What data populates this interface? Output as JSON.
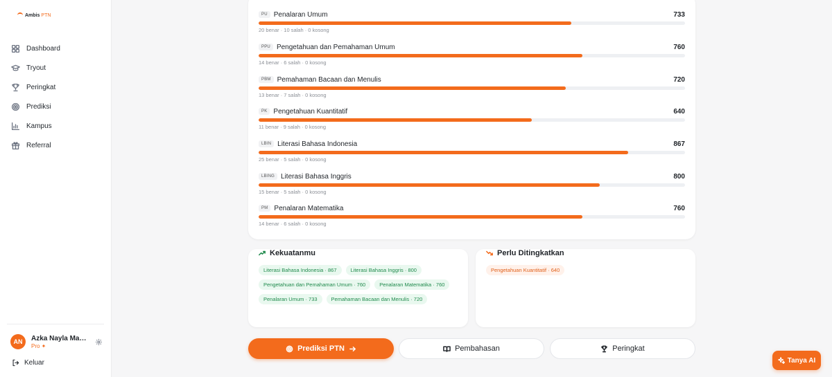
{
  "brand": {
    "name": "Ambis",
    "suffix": "PTN"
  },
  "sidebar": {
    "items": [
      {
        "label": "Dashboard",
        "icon": "grid-icon"
      },
      {
        "label": "Tryout",
        "icon": "graduation-cap-icon"
      },
      {
        "label": "Peringkat",
        "icon": "trophy-icon"
      },
      {
        "label": "Prediksi",
        "icon": "target-icon"
      },
      {
        "label": "Kampus",
        "icon": "bar-chart-icon"
      },
      {
        "label": "Referral",
        "icon": "gift-icon"
      }
    ],
    "user": {
      "initials": "AN",
      "name": "Azka Nayla Maymuna",
      "plan": "Pro ✦"
    },
    "logout_label": "Keluar"
  },
  "subtests": [
    {
      "code": "PU",
      "name": "Penalaran Umum",
      "score": "733",
      "progress": 73.3,
      "stats": "20 benar · 10 salah · 0 kosong"
    },
    {
      "code": "PPU",
      "name": "Pengetahuan dan Pemahaman Umum",
      "score": "760",
      "progress": 76.0,
      "stats": "14 benar · 6 salah · 0 kosong"
    },
    {
      "code": "PBM",
      "name": "Pemahaman Bacaan dan Menulis",
      "score": "720",
      "progress": 72.0,
      "stats": "13 benar · 7 salah · 0 kosong"
    },
    {
      "code": "PK",
      "name": "Pengetahuan Kuantitatif",
      "score": "640",
      "progress": 64.0,
      "stats": "11 benar · 9 salah · 0 kosong"
    },
    {
      "code": "LBIN",
      "name": "Literasi Bahasa Indonesia",
      "score": "867",
      "progress": 86.7,
      "stats": "25 benar · 5 salah · 0 kosong"
    },
    {
      "code": "LBING",
      "name": "Literasi Bahasa Inggris",
      "score": "800",
      "progress": 80.0,
      "stats": "15 benar · 5 salah · 0 kosong"
    },
    {
      "code": "PM",
      "name": "Penalaran Matematika",
      "score": "760",
      "progress": 76.0,
      "stats": "14 benar · 6 salah · 0 kosong"
    }
  ],
  "strengths": {
    "title": "Kekuatanmu",
    "items": [
      "Literasi Bahasa Indonesia · 867",
      "Literasi Bahasa Inggris · 800",
      "Pengetahuan dan Pemahaman Umum · 760",
      "Penalaran Matematika · 760",
      "Penalaran Umum · 733",
      "Pemahaman Bacaan dan Menulis · 720"
    ]
  },
  "improvements": {
    "title": "Perlu Ditingkatkan",
    "items": [
      "Pengetahuan Kuantitatif · 640"
    ]
  },
  "actions": {
    "predict_label": "Prediksi PTN",
    "discussion_label": "Pembahasan",
    "ranking_label": "Peringkat"
  },
  "ask_ai_label": "Tanya AI",
  "colors": {
    "accent": "#f36b1c",
    "good": "#1f8a4c",
    "good_bg": "#e9f8ef"
  }
}
